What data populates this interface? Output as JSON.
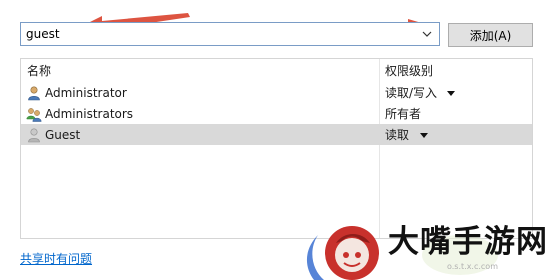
{
  "user_input": {
    "value": "guest"
  },
  "add_button": {
    "label": "添加(A)"
  },
  "table": {
    "columns": [
      "名称",
      "权限级别"
    ],
    "rows": [
      {
        "name": "Administrator",
        "permission": "读取/写入",
        "has_dropdown": true,
        "icon": "user-icon",
        "selected": false
      },
      {
        "name": "Administrators",
        "permission": "所有者",
        "has_dropdown": false,
        "icon": "group-icon",
        "selected": false
      },
      {
        "name": "Guest",
        "permission": "读取",
        "has_dropdown": true,
        "icon": "guest-user-icon",
        "selected": true
      }
    ]
  },
  "help_link": {
    "label": "共享时有问题"
  },
  "watermark": {
    "text": "大嘴手游网",
    "url": "o.s.t.x.c.com"
  },
  "colors": {
    "annotation_arrow": "#d9412c",
    "selected_row": "#d9d9d9",
    "link": "#0066cc",
    "input_border": "#7a9cc6"
  }
}
